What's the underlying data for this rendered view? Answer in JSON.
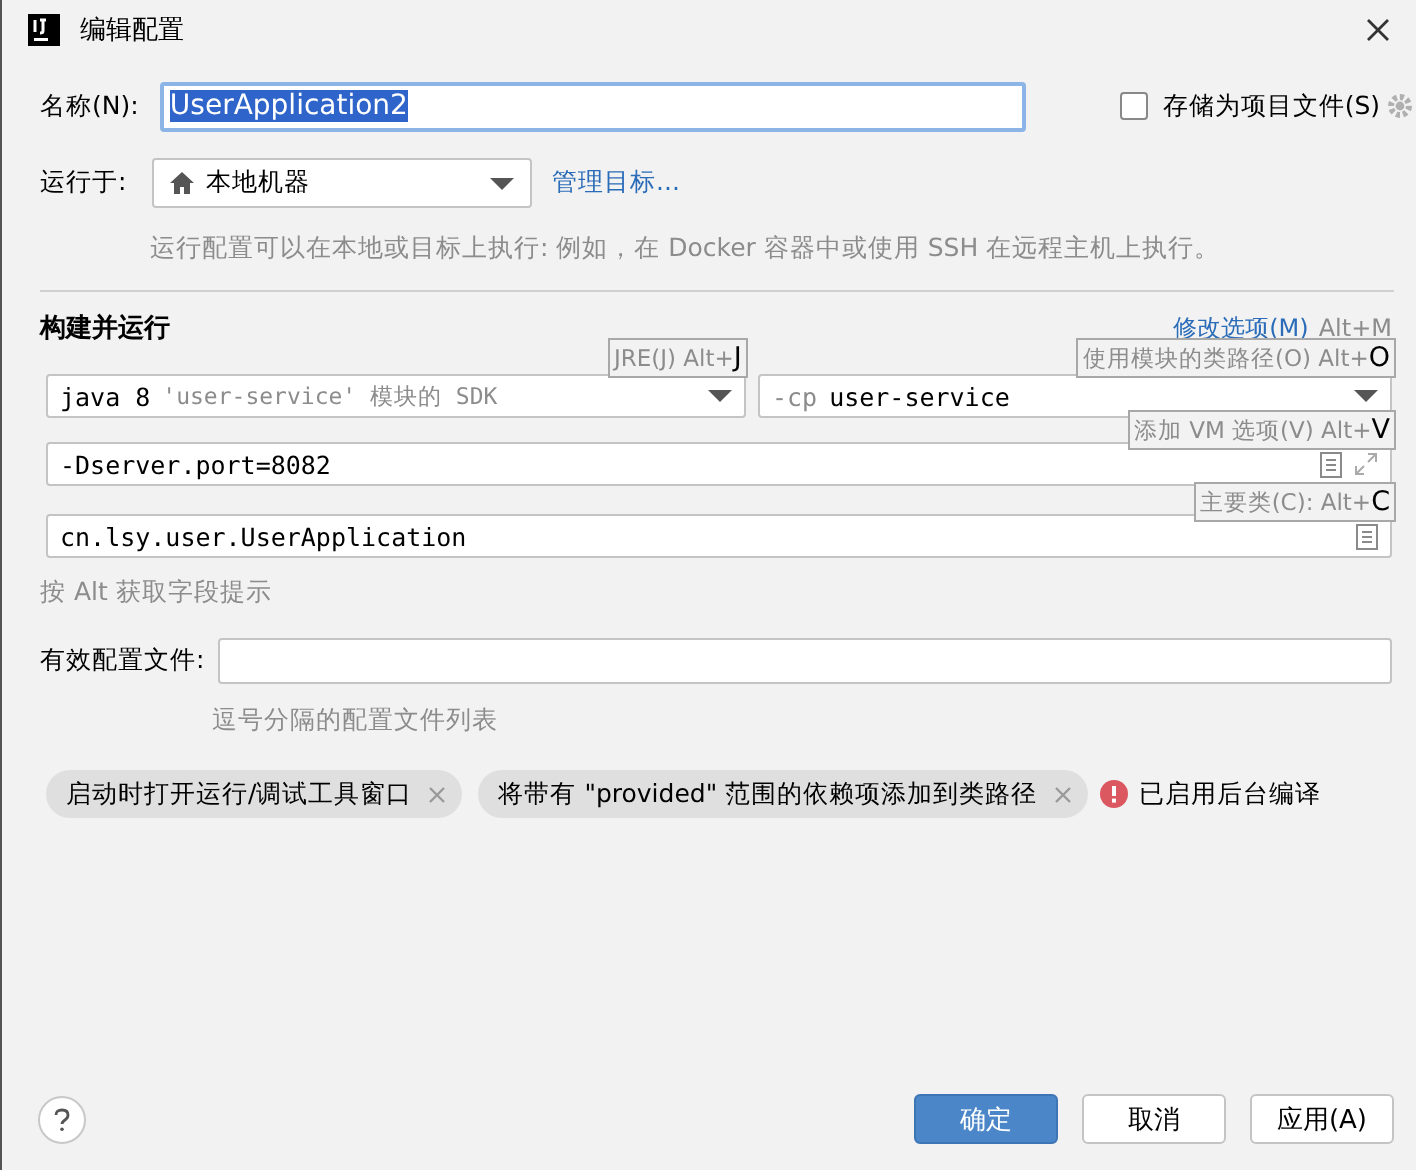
{
  "window": {
    "title": "编辑配置"
  },
  "name_row": {
    "label": "名称(N):",
    "value": "UserApplication2",
    "selected": true,
    "store_checkbox": {
      "label": "存储为项目文件(S)",
      "checked": false
    }
  },
  "run_on": {
    "label": "运行于:",
    "value": "本地机器",
    "link": "管理目标...",
    "hint": "运行配置可以在本地或目标上执行: 例如，在 Docker 容器中或使用 SSH 在远程主机上执行。"
  },
  "section": {
    "title": "构建并运行",
    "modify_link": "修改选项(M)",
    "modify_shortcut": "Alt+M"
  },
  "jre": {
    "prefix": "java 8",
    "detail": "'user-service' 模块的 SDK"
  },
  "classpath": {
    "prefix": "-cp",
    "value": "user-service"
  },
  "vm_options": {
    "value": "-Dserver.port=8082"
  },
  "main_class": {
    "value": "cn.lsy.user.UserApplication"
  },
  "field_hint": "按 Alt 获取字段提示",
  "profiles": {
    "label": "有效配置文件:",
    "hint": "逗号分隔的配置文件列表"
  },
  "tooltips": [
    {
      "text": "JRE(J) Alt+",
      "key": "J"
    },
    {
      "text": "使用模块的类路径(O) Alt+",
      "key": "O"
    },
    {
      "text": "添加 VM 选项(V) Alt+",
      "key": "V"
    },
    {
      "text": "主要类(C): Alt+",
      "key": "C"
    }
  ],
  "chips": [
    {
      "label": "启动时打开运行/调试工具窗口"
    },
    {
      "label": "将带有 \"provided\" 范围的依赖项添加到类路径"
    }
  ],
  "warning": "已启用后台编译",
  "buttons": [
    {
      "label": "确定",
      "kind": "primary"
    },
    {
      "label": "取消",
      "kind": "normal"
    },
    {
      "label": "应用(A)",
      "kind": "normal"
    }
  ]
}
